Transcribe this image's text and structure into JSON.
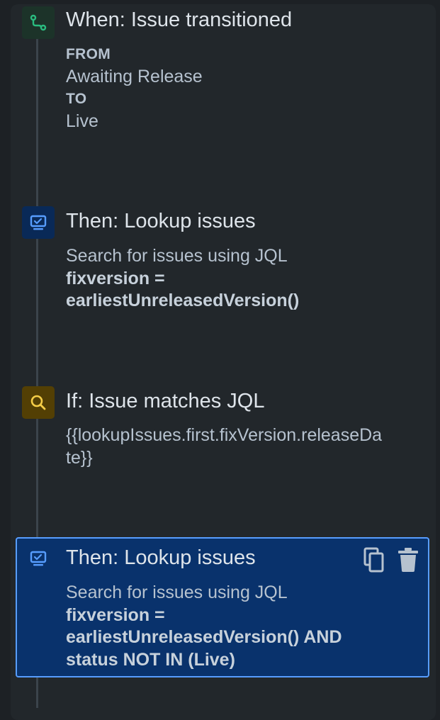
{
  "steps": [
    {
      "icon": "branch-icon",
      "title": "When: Issue transitioned",
      "from_label": "FROM",
      "from_value": "Awaiting Release",
      "to_label": "TO",
      "to_value": "Live"
    },
    {
      "icon": "monitor-icon",
      "title": "Then: Lookup issues",
      "description": "Search for issues using JQL",
      "jql_line1": "fixversion =",
      "jql_line2": "earliestUnreleasedVersion()"
    },
    {
      "icon": "search-icon",
      "title": "If: Issue matches JQL",
      "jql_line1": "{{lookupIssues.first.fixVersion.releaseDa",
      "jql_line2": "te}}"
    },
    {
      "icon": "monitor-icon",
      "title": "Then: Lookup issues",
      "description": "Search for issues using JQL",
      "jql_line1": "fixversion =",
      "jql_line2": "earliestUnreleasedVersion() AND",
      "jql_line3": "status NOT IN (Live)",
      "selected": true
    }
  ],
  "actions": {
    "copy_icon": "copy-icon",
    "delete_icon": "trash-icon"
  },
  "colors": {
    "trigger_icon_bg": "#1c3329",
    "trigger_icon": "#2abb7f",
    "action_icon_bg": "#092957",
    "action_icon": "#579dff",
    "condition_icon_bg": "#533f04",
    "condition_icon": "#f5cd47",
    "selected_bg": "#09326c",
    "selected_border": "#579dff"
  }
}
